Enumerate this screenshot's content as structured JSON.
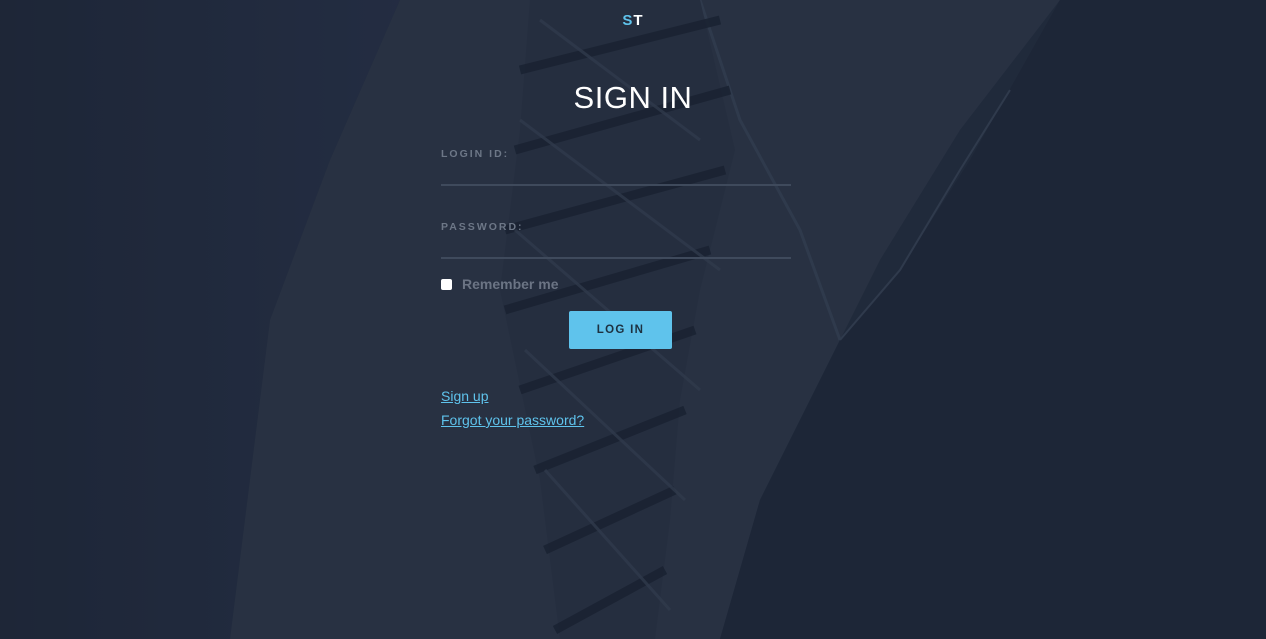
{
  "logo": {
    "first_letter": "S",
    "second_letter": "T"
  },
  "title": "SIGN IN",
  "login_field": {
    "label": "LOGIN ID:",
    "value": ""
  },
  "password_field": {
    "label": "PASSWORD:",
    "value": ""
  },
  "remember": {
    "label": "Remember me",
    "checked": false
  },
  "login_button": {
    "label": "LOG IN"
  },
  "links": {
    "sign_up": "Sign up",
    "forgot_password": "Forgot your password?"
  },
  "colors": {
    "accent": "#5fc3ec",
    "background": "#232d3e",
    "text": "#ffffff",
    "muted_label": "#6d7787"
  },
  "background_image": "blurred dark photo of a suit and patterned tie"
}
